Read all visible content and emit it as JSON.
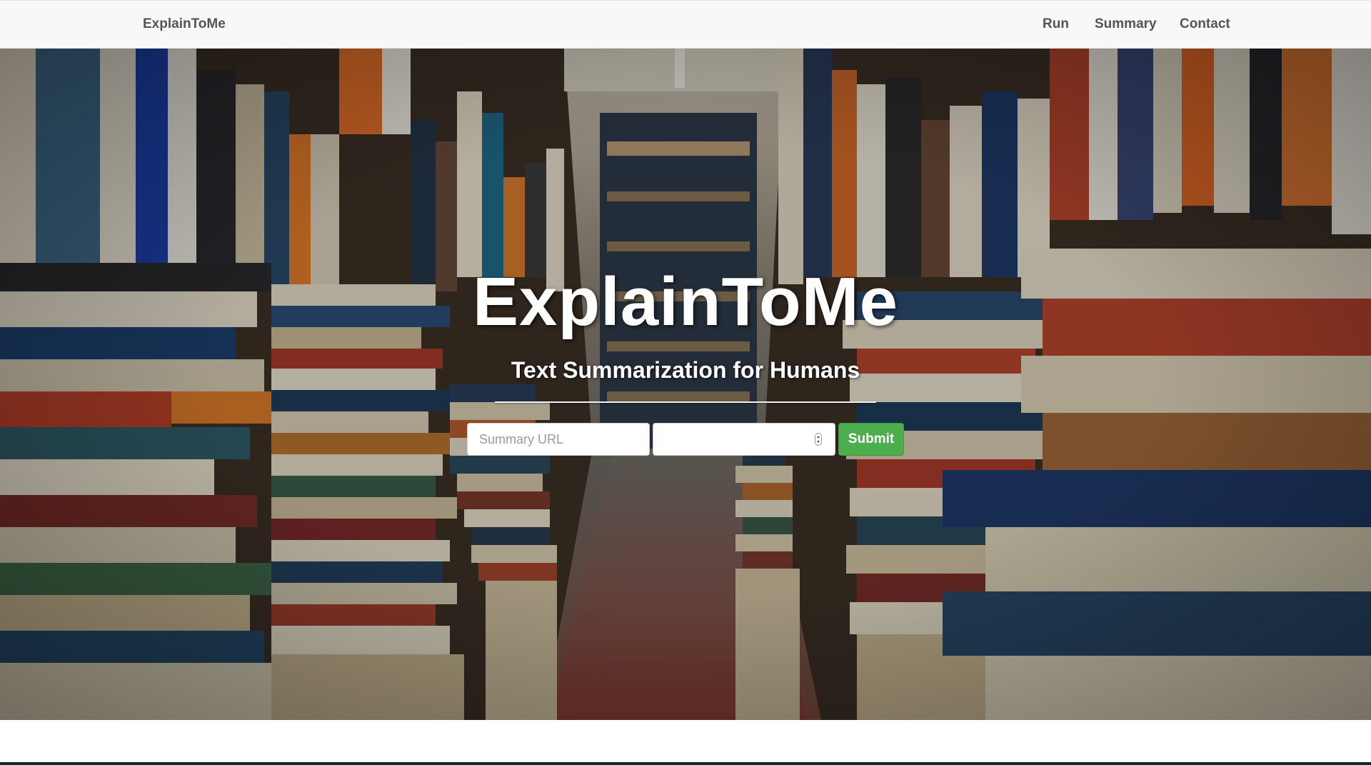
{
  "navbar": {
    "brand": "ExplainToMe",
    "links": [
      {
        "label": "Run"
      },
      {
        "label": "Summary"
      },
      {
        "label": "Contact"
      }
    ]
  },
  "hero": {
    "title": "ExplainToMe",
    "subtitle": "Text Summarization for Humans",
    "form": {
      "url_placeholder": "Summary URL",
      "url_value": "",
      "number_value": "",
      "submit_label": "Submit"
    }
  },
  "colors": {
    "navbar_bg": "#f8f8f8",
    "nav_text": "#555555",
    "submit_bg": "#4cae4c",
    "hero_text": "#ffffff",
    "bottom_bar": "#0d2b32"
  },
  "icons": {
    "number_spinner": "spinner-arrows-icon",
    "background": "library-bookshelves-image"
  }
}
